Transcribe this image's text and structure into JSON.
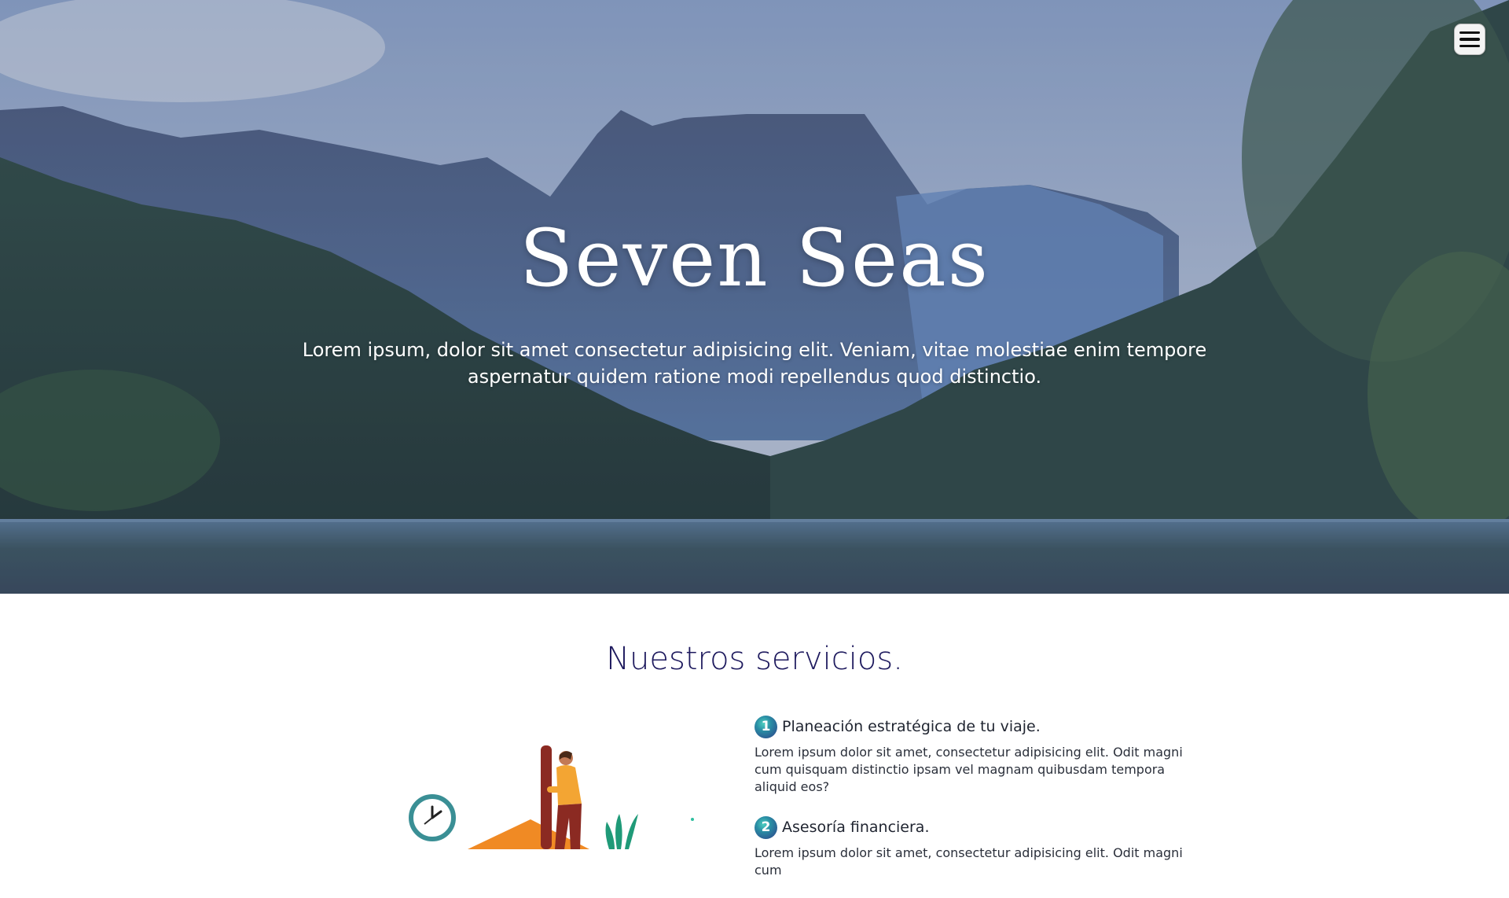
{
  "hero": {
    "title": "Seven Seas",
    "subtitle": "Lorem ipsum, dolor sit amet consectetur adipisicing elit. Veniam, vitae molestiae enim tempore aspernatur quidem ratione modi repellendus quod distinctio."
  },
  "menu": {
    "icon": "hamburger-menu-icon"
  },
  "services": {
    "title": "Nuestros servicios.",
    "items": [
      {
        "number": "1",
        "title": "Planeación estratégica de tu viaje.",
        "description": "Lorem ipsum dolor sit amet, consectetur adipisicing elit. Odit magni cum quisquam distinctio ipsam vel magnam quibusdam tempora aliquid eos?"
      },
      {
        "number": "2",
        "title": "Asesoría financiera.",
        "description": "Lorem ipsum dolor sit amet, consectetur adipisicing elit. Odit magni cum"
      }
    ]
  },
  "colors": {
    "title_accent": "#1e1a5e",
    "number_badge": "#2a8fa5",
    "illustration_orange": "#f08a24"
  }
}
